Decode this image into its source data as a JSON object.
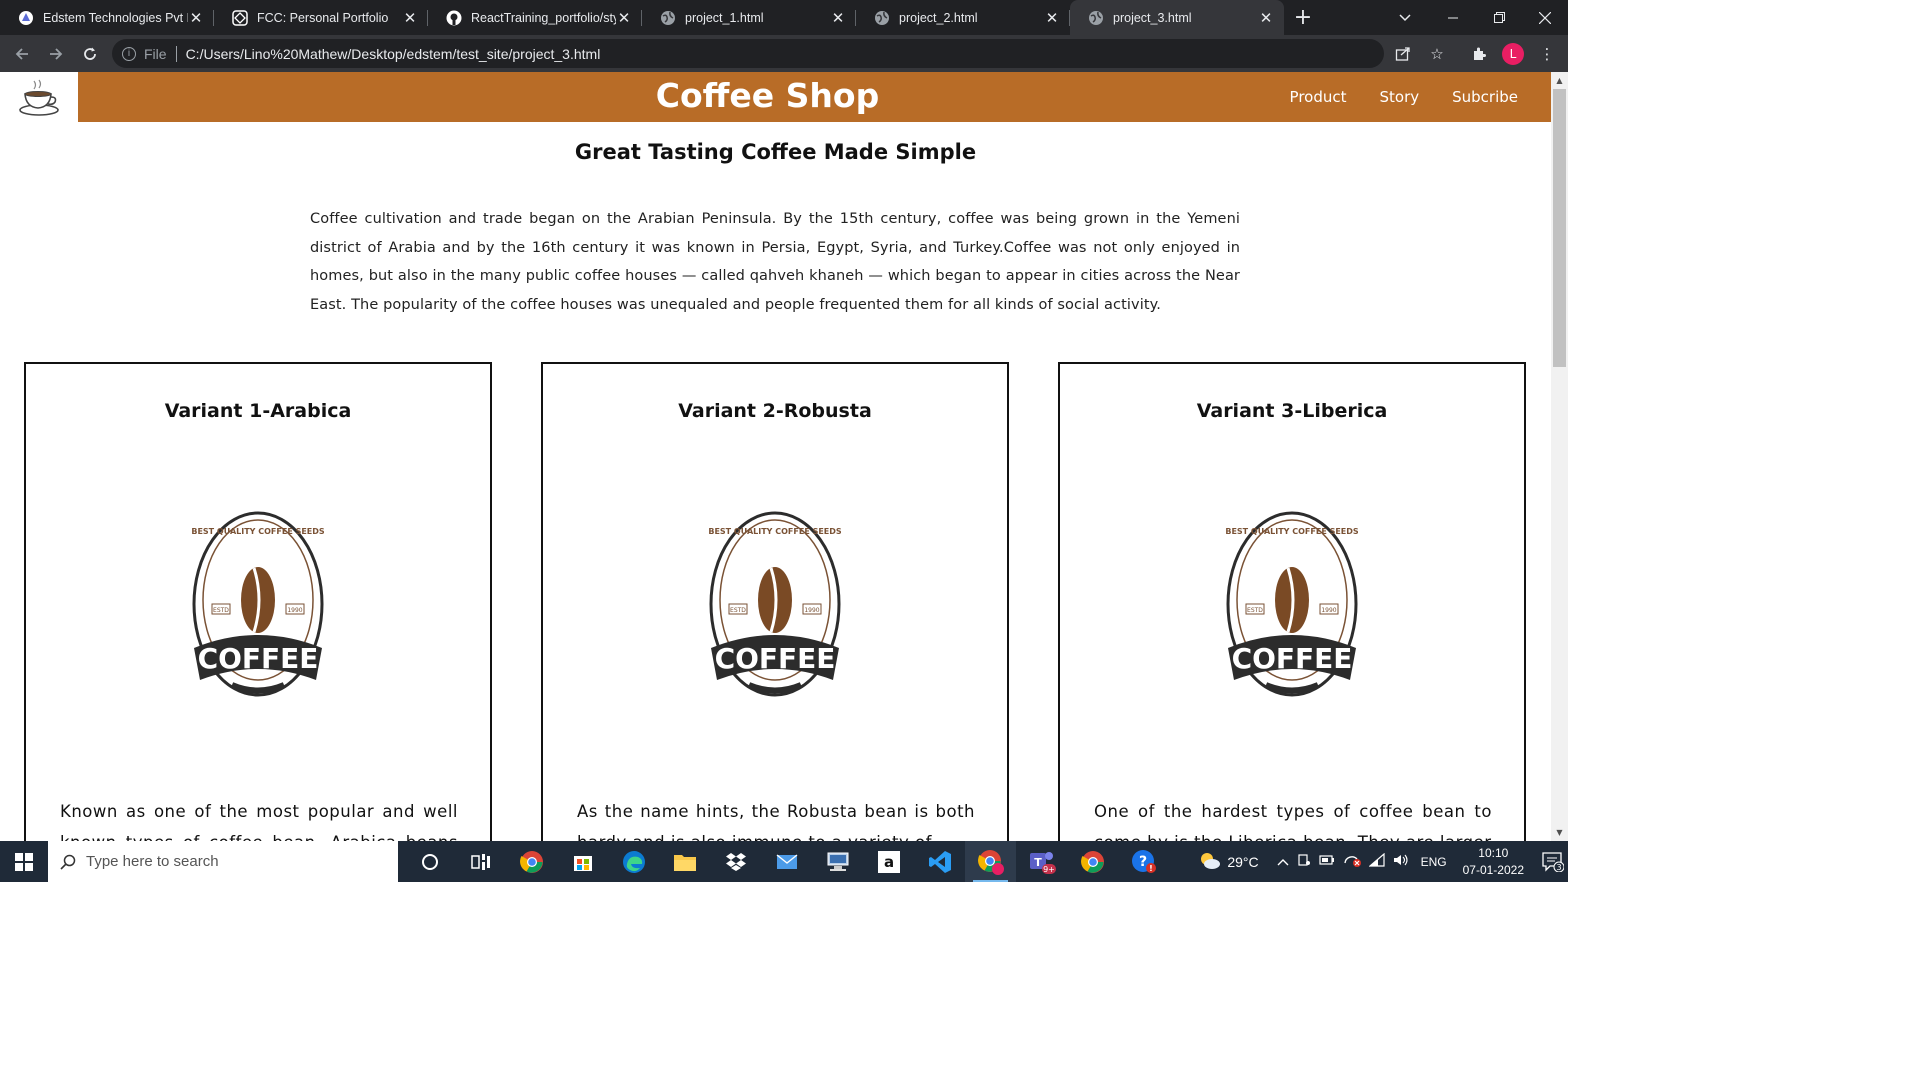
{
  "browser": {
    "tabs": [
      {
        "title": "Edstem Technologies Pvt Lt",
        "icon": "edstem-icon",
        "active": false
      },
      {
        "title": "FCC: Personal Portfolio",
        "icon": "codepen-icon",
        "active": false
      },
      {
        "title": "ReactTraining_portfolio/styl",
        "icon": "github-icon",
        "active": false
      },
      {
        "title": "project_1.html",
        "icon": "globe-icon",
        "active": false
      },
      {
        "title": "project_2.html",
        "icon": "globe-icon",
        "active": false
      },
      {
        "title": "project_3.html",
        "icon": "globe-icon",
        "active": true
      }
    ],
    "address": {
      "scheme_label": "File",
      "url": "C:/Users/Lino%20Mathew/Desktop/edstem/test_site/project_3.html"
    },
    "profile_initial": "L",
    "colors": {
      "frame": "#202124",
      "toolbar": "#35363a",
      "profile": "#e91e63"
    }
  },
  "site": {
    "title": "Coffee Shop",
    "nav": [
      "Product",
      "Story",
      "Subcribe"
    ],
    "header_color": "#b86c27",
    "headline": "Great Tasting Coffee Made Simple",
    "intro": "Coffee cultivation and trade began on the Arabian Peninsula. By the 15th century, coffee was being grown in the Yemeni district of Arabia and by the 16th century it was known in Persia, Egypt, Syria, and Turkey.Coffee was not only enjoyed in homes, but also in the many public coffee houses — called qahveh khaneh — which began to appear in cities across the Near East. The popularity of the coffee houses was unequaled and people frequented them for all kinds of social activity.",
    "variants": [
      {
        "title": "Variant 1-Arabica",
        "text": "Known as one of the most popular and well known types of coffee bean, Arabica beans are"
      },
      {
        "title": "Variant 2-Robusta",
        "text": "As the name hints, the Robusta bean is both hardy and is also immune to a variety of"
      },
      {
        "title": "Variant 3-Liberica",
        "text": "One of the hardest types of coffee bean to come by is the Liberica bean. They are larger"
      }
    ],
    "badge": {
      "ring_text": "BEST QUALITY COFFEE SEEDS",
      "left_tag": "ESTD",
      "right_tag": "1990",
      "banner": "COFFEE"
    }
  },
  "taskbar": {
    "search_placeholder": "Type here to search",
    "apps": [
      "task-view-icon",
      "widgets-icon",
      "chrome-icon",
      "store-icon",
      "edge-icon",
      "file-explorer-icon",
      "dropbox-icon",
      "mail-icon",
      "network-drive-icon",
      "amazon-icon",
      "vscode-icon",
      "chrome-profile-icon",
      "teams-icon",
      "chrome-icon",
      "help-icon"
    ],
    "teams_badge": "9+",
    "temperature": "29°C",
    "language": "ENG",
    "time": "10:10",
    "date": "07-01-2022",
    "notifications": "3"
  }
}
